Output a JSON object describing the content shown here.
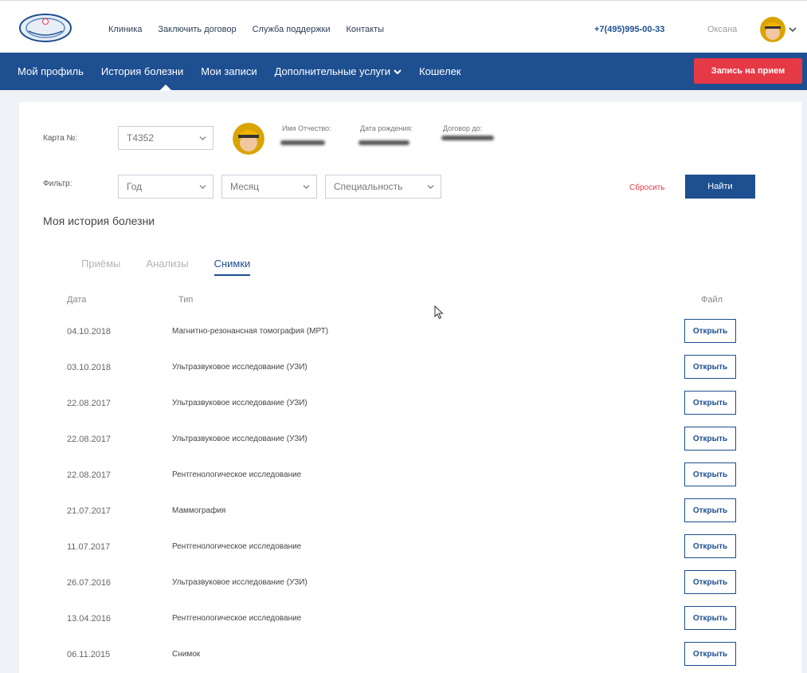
{
  "header": {
    "nav": [
      "Клиника",
      "Заключить договор",
      "Служба поддержки",
      "Контакты"
    ],
    "phone": "+7(495)995-00-33",
    "user_name": "Оксана"
  },
  "main_nav": {
    "items": [
      "Мой профиль",
      "История болезни",
      "Мои записи",
      "Дополнительные услуги",
      "Кошелек"
    ],
    "active": "История болезни",
    "cta": "Запись на прием"
  },
  "card_info": {
    "card_label": "Карта №:",
    "card_number": "T4352",
    "name_label": "Имя Отчество:",
    "birth_label": "Дата рождения:",
    "contract_label": "Договор до:"
  },
  "filter": {
    "label": "Фильтр:",
    "year": "Год",
    "month": "Месяц",
    "specialty": "Специальность",
    "reset": "Сбросить",
    "find": "Найти"
  },
  "history": {
    "title": "Моя история болезни",
    "tabs": [
      "Приёмы",
      "Анализы",
      "Снимки"
    ],
    "active_tab": "Снимки",
    "columns": [
      "Дата",
      "Тип",
      "Файл"
    ],
    "open_label": "Открыть",
    "rows": [
      {
        "date": "04.10.2018",
        "type": "Магнитно-резонансная томография (МРТ)"
      },
      {
        "date": "03.10.2018",
        "type": "Ультразвуковое исследование (УЗИ)"
      },
      {
        "date": "22.08.2017",
        "type": "Ультразвуковое исследование (УЗИ)"
      },
      {
        "date": "22.08.2017",
        "type": "Ультразвуковое исследование (УЗИ)"
      },
      {
        "date": "22.08.2017",
        "type": "Рентгенологическое исследование"
      },
      {
        "date": "21.07.2017",
        "type": "Маммография"
      },
      {
        "date": "11.07.2017",
        "type": "Рентгенологическое исследование"
      },
      {
        "date": "26.07.2016",
        "type": "Ультразвуковое исследование (УЗИ)"
      },
      {
        "date": "13.04.2016",
        "type": "Рентгенологическое исследование"
      },
      {
        "date": "06.11.2015",
        "type": "Снимок"
      }
    ]
  },
  "colors": {
    "primary": "#1d4f91",
    "accent": "#e63946"
  }
}
